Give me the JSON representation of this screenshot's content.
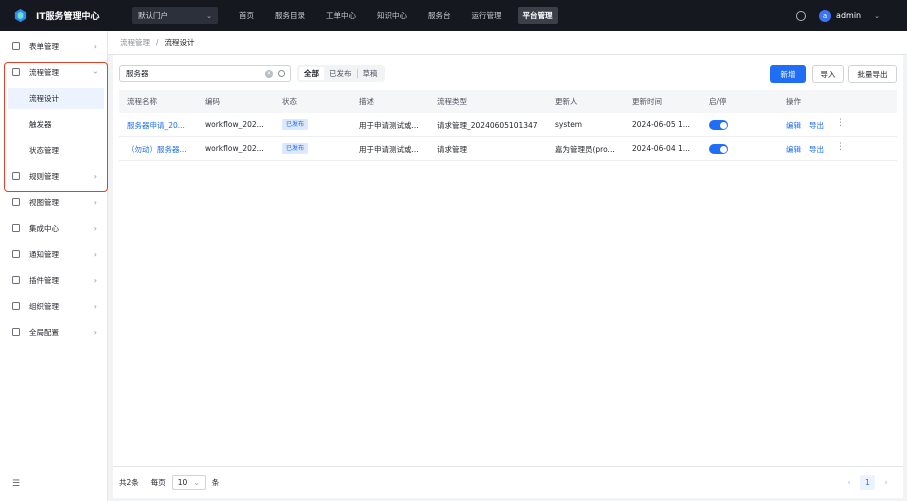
{
  "header": {
    "brand": "IT服务管理中心",
    "portal_select": "默认门户",
    "nav": [
      "首页",
      "服务目录",
      "工单中心",
      "知识中心",
      "服务台",
      "运行管理",
      "平台管理"
    ],
    "active_nav": "平台管理",
    "user_initial": "a",
    "username": "admin"
  },
  "sidebar": {
    "items": [
      {
        "label": "表单管理",
        "icon": "form-icon"
      },
      {
        "label": "流程管理",
        "icon": "process-icon"
      },
      {
        "label": "规则管理",
        "icon": "rule-icon"
      },
      {
        "label": "视图管理",
        "icon": "view-icon"
      },
      {
        "label": "集成中心",
        "icon": "integration-icon"
      },
      {
        "label": "通知管理",
        "icon": "bell-icon"
      },
      {
        "label": "插件管理",
        "icon": "plugin-icon"
      },
      {
        "label": "组织管理",
        "icon": "org-icon"
      },
      {
        "label": "全局配置",
        "icon": "settings-icon"
      }
    ],
    "sub_items": [
      "流程设计",
      "触发器",
      "状态管理"
    ],
    "active_sub": "流程设计"
  },
  "breadcrumb": {
    "parent": "流程管理",
    "sep": "/",
    "current": "流程设计"
  },
  "toolbar": {
    "search_value": "服务器",
    "filters": [
      "全部",
      "已发布",
      "草稿"
    ],
    "active_filter": "全部",
    "btn_new": "新增",
    "btn_import": "导入",
    "btn_export": "批量导出"
  },
  "table": {
    "columns": [
      "流程名称",
      "编码",
      "状态",
      "描述",
      "流程类型",
      "更新人",
      "更新时间",
      "启/停",
      "操作"
    ],
    "rows": [
      {
        "name": "服务器申请_20...",
        "code": "workflow_202...",
        "status": "已发布",
        "desc": "用于申请测试或...",
        "type": "请求管理_20240605101347",
        "updater": "system",
        "time": "2024-06-05 1...",
        "enabled": true,
        "action_edit": "编辑",
        "action_export": "导出"
      },
      {
        "name": "（勿动）服务器...",
        "code": "workflow_202...",
        "status": "已发布",
        "desc": "用于申请测试或...",
        "type": "请求管理",
        "updater": "嘉为管理员(pro...",
        "time": "2024-06-04 1...",
        "enabled": true,
        "action_edit": "编辑",
        "action_export": "导出"
      }
    ]
  },
  "footer": {
    "total": "共2条",
    "per_page_label": "每页",
    "page_size": "10",
    "unit": "条",
    "current_page": "1"
  },
  "colors": {
    "primary": "#1f6ef5",
    "topbar": "#15181f",
    "highlight": "#e3402a"
  }
}
